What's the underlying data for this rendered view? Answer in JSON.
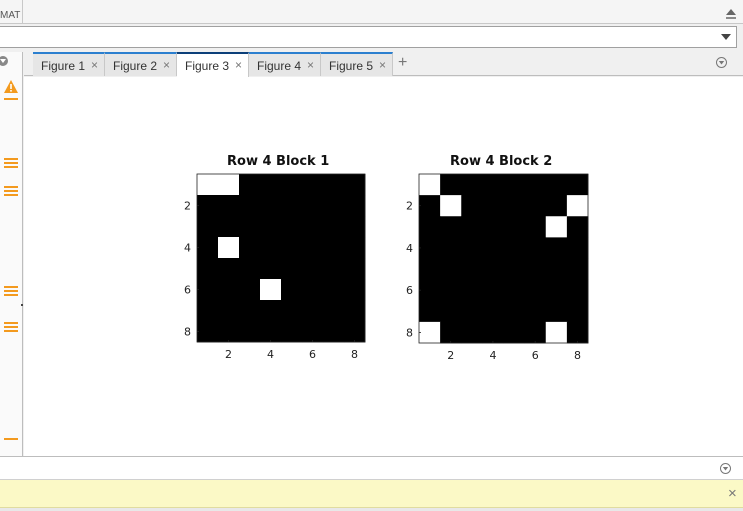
{
  "toolstrip": {
    "fragment_label": "MAT",
    "collapse_icon": "collapse-up-icon"
  },
  "address": {
    "value": "",
    "dropdown_icon": "chevron-down-icon"
  },
  "gutter": {
    "items": [
      "warning-icon",
      "dash",
      "lines",
      "lines",
      "lines",
      "lines",
      "dash"
    ]
  },
  "tabs": [
    {
      "label": "Figure 1",
      "close": "×",
      "active": false
    },
    {
      "label": "Figure 2",
      "close": "×",
      "active": false
    },
    {
      "label": "Figure 3",
      "close": "×",
      "active": true
    },
    {
      "label": "Figure 4",
      "close": "×",
      "active": false
    },
    {
      "label": "Figure 5",
      "close": "×",
      "active": false
    }
  ],
  "add_tab_label": "+",
  "notice": {
    "close_label": "×"
  },
  "colors": {
    "accent": "#2b7fcf",
    "active_tab": "#0c3f79",
    "warning": "#f39a1e",
    "notice_bg": "#fbf9c6"
  },
  "chart_data": [
    {
      "type": "heatmap",
      "title": "Row 4 Block 1",
      "rows": 8,
      "cols": 8,
      "x_ticks": [
        2,
        4,
        6,
        8
      ],
      "y_ticks": [
        2,
        4,
        6,
        8
      ],
      "colormap": [
        "#000000",
        "#ffffff"
      ],
      "values": [
        [
          1,
          1,
          0,
          0,
          0,
          0,
          0,
          0
        ],
        [
          0,
          0,
          0,
          0,
          0,
          0,
          0,
          0
        ],
        [
          0,
          0,
          0,
          0,
          0,
          0,
          0,
          0
        ],
        [
          0,
          1,
          0,
          0,
          0,
          0,
          0,
          0
        ],
        [
          0,
          0,
          0,
          0,
          0,
          0,
          0,
          0
        ],
        [
          0,
          0,
          0,
          1,
          0,
          0,
          0,
          0
        ],
        [
          0,
          0,
          0,
          0,
          0,
          0,
          0,
          0
        ],
        [
          0,
          0,
          0,
          0,
          0,
          0,
          0,
          0
        ]
      ]
    },
    {
      "type": "heatmap",
      "title": "Row 4 Block 2",
      "rows": 8,
      "cols": 8,
      "x_ticks": [
        2,
        4,
        6,
        8
      ],
      "y_ticks": [
        2,
        4,
        6,
        8
      ],
      "colormap": [
        "#000000",
        "#ffffff"
      ],
      "values": [
        [
          1,
          0,
          0,
          0,
          0,
          0,
          0,
          0
        ],
        [
          0,
          1,
          0,
          0,
          0,
          0,
          0,
          1
        ],
        [
          0,
          0,
          0,
          0,
          0,
          0,
          1,
          0
        ],
        [
          0,
          0,
          0,
          0,
          0,
          0,
          0,
          0
        ],
        [
          0,
          0,
          0,
          0,
          0,
          0,
          0,
          0
        ],
        [
          0,
          0,
          0,
          0,
          0,
          0,
          0,
          0
        ],
        [
          0,
          0,
          0,
          0,
          0,
          0,
          0,
          0
        ],
        [
          1,
          0,
          0,
          0,
          0,
          0,
          1,
          0
        ]
      ]
    }
  ]
}
